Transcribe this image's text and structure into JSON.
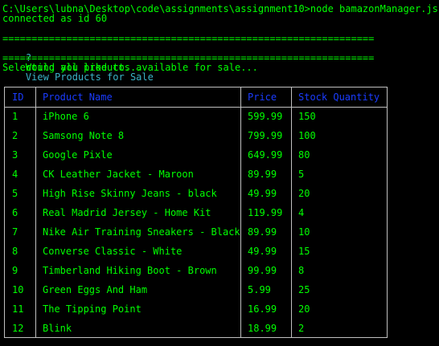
{
  "terminal": {
    "command_line": "C:\\Users\\lubna\\Desktop\\code\\assignments\\assignment10>node bamazonManager.js",
    "connected_line": "connected as id 60",
    "separator": "================================================================",
    "prompt_marker": "?",
    "prompt_text": "Would you like to...",
    "prompt_answer": "View Products for Sale",
    "status_line": "Selecting all products available for sale..."
  },
  "table": {
    "headers": [
      "ID",
      "Product Name",
      "Price",
      "Stock Quantity"
    ],
    "rows": [
      [
        "1",
        "iPhone 6",
        "599.99",
        "150"
      ],
      [
        "2",
        "Samsong Note 8",
        "799.99",
        "100"
      ],
      [
        "3",
        "Google Pixle",
        "649.99",
        "80"
      ],
      [
        "4",
        "CK Leather Jacket - Maroon",
        "89.99",
        "5"
      ],
      [
        "5",
        "High Rise Skinny Jeans - black",
        "49.99",
        "20"
      ],
      [
        "6",
        "Real Madrid Jersey - Home Kit",
        "119.99",
        "4"
      ],
      [
        "7",
        "Nike Air Training Sneakers - Black",
        "89.99",
        "10"
      ],
      [
        "8",
        "Converse Classic - White",
        "49.99",
        "15"
      ],
      [
        "9",
        "Timberland Hiking Boot - Brown",
        "99.99",
        "8"
      ],
      [
        "10",
        "Green Eggs And Ham",
        "5.99",
        "25"
      ],
      [
        "11",
        "The Tipping Point",
        "16.99",
        "20"
      ],
      [
        "12",
        "Blink",
        "18.99",
        "2"
      ]
    ]
  },
  "colors": {
    "background": "#000000",
    "text_green": "#00ff00",
    "prompt_cyan": "#3bb3c7",
    "header_blue": "#1a3cff",
    "border_gray": "#c0c0c0"
  }
}
